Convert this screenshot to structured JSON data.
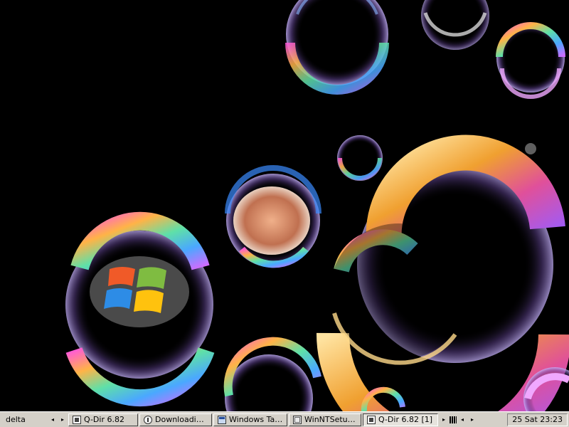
{
  "desktop": {
    "wallpaper": "soap-bubbles",
    "logo": "windows-logo"
  },
  "taskbar": {
    "user": "delta",
    "buttons": [
      {
        "label": "Q-Dir 6.82",
        "icon": "qdir-icon",
        "active": false
      },
      {
        "label": "Downloading ...",
        "icon": "download-icon",
        "active": false
      },
      {
        "label": "Windows Task ...",
        "icon": "task-manager-icon",
        "active": false
      },
      {
        "label": "WinNTSetup 4...",
        "icon": "setup-icon",
        "active": false
      },
      {
        "label": "Q-Dir 6.82 [1]",
        "icon": "qdir-icon",
        "active": true
      }
    ],
    "clock": "25 Sat 23:23",
    "colors": {
      "bar": "#d4d0c8",
      "desktop": "#000000"
    }
  }
}
